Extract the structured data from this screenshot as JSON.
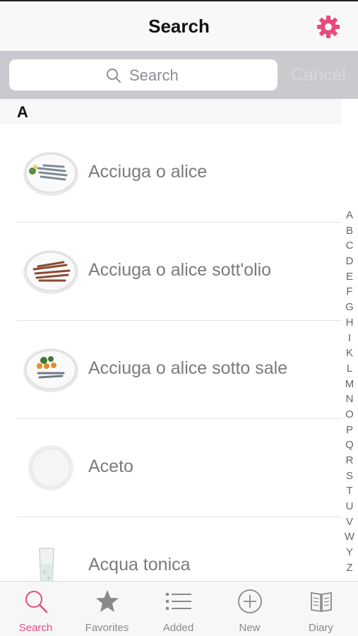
{
  "header": {
    "title": "Search",
    "settings_icon": "gear-icon"
  },
  "search": {
    "placeholder": "Search",
    "cancel_label": "Cancel"
  },
  "section": {
    "letter": "A"
  },
  "list": {
    "items": [
      {
        "label": "Acciuga o alice",
        "icon": "anchovy-plate-icon"
      },
      {
        "label": "Acciuga o alice sott'olio",
        "icon": "anchovy-oil-plate-icon"
      },
      {
        "label": "Acciuga o alice sotto sale",
        "icon": "salted-anchovy-plate-icon"
      },
      {
        "label": "Aceto",
        "icon": "empty-plate-icon"
      },
      {
        "label": "Acqua tonica",
        "icon": "glass-icon"
      }
    ]
  },
  "index": [
    "A",
    "B",
    "C",
    "D",
    "E",
    "F",
    "G",
    "H",
    "I",
    "K",
    "L",
    "M",
    "N",
    "O",
    "P",
    "Q",
    "R",
    "S",
    "T",
    "U",
    "V",
    "W",
    "Y",
    "Z"
  ],
  "tabbar": {
    "active": "Search",
    "tabs": [
      {
        "label": "Search",
        "icon": "search-icon"
      },
      {
        "label": "Favorites",
        "icon": "star-icon"
      },
      {
        "label": "Added",
        "icon": "list-icon"
      },
      {
        "label": "New",
        "icon": "plus-circle-icon"
      },
      {
        "label": "Diary",
        "icon": "book-icon"
      }
    ]
  },
  "colors": {
    "accent": "#e84a7c",
    "searchbar_bg": "#c9c9ce",
    "cancel_text": "#d8d8dc"
  }
}
